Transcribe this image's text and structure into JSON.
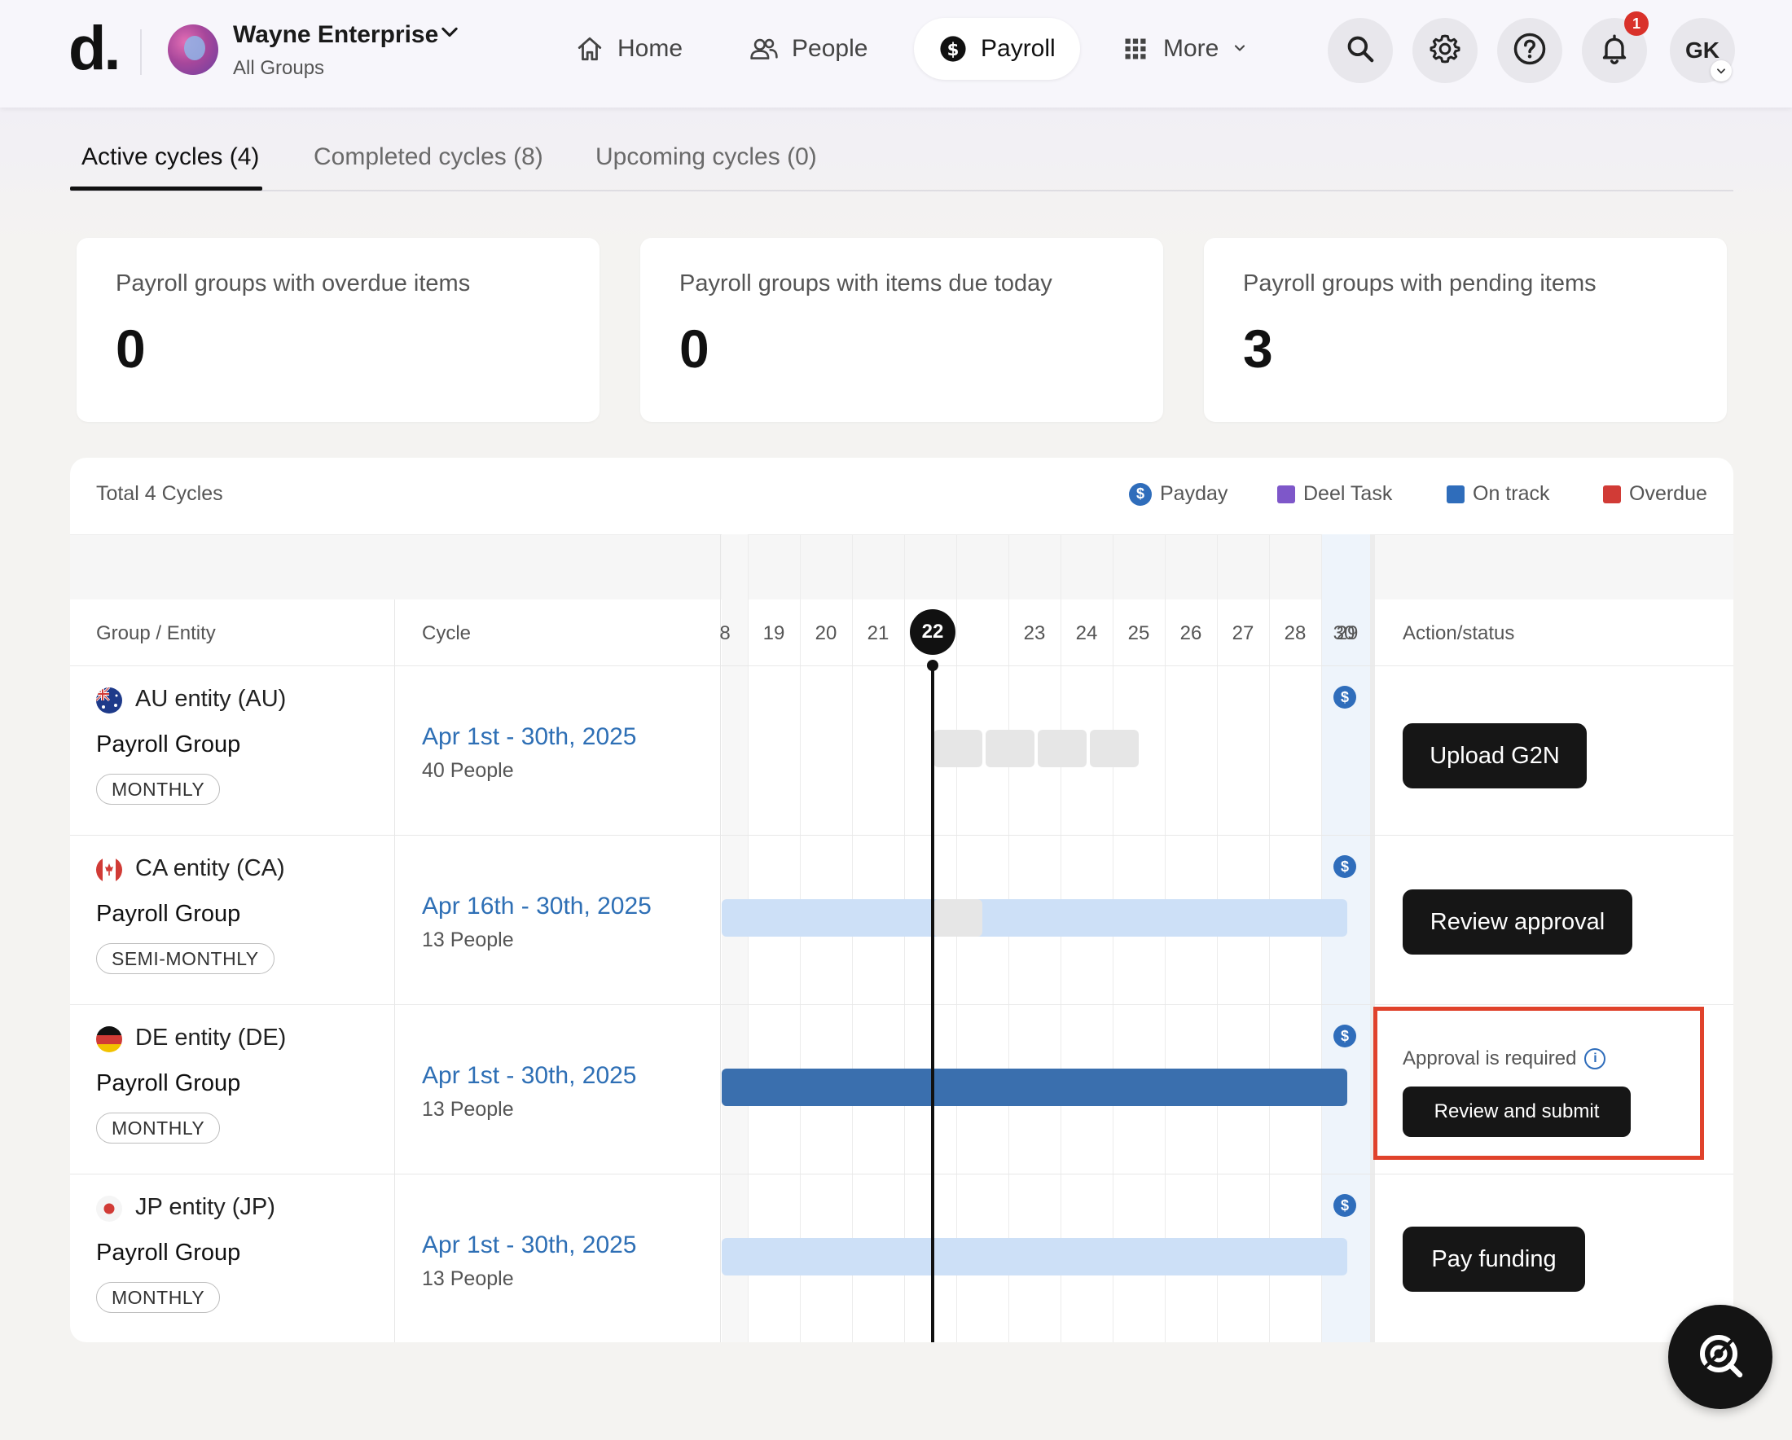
{
  "header": {
    "logo": "d.",
    "org_name": "Wayne Enterprise",
    "org_sub": "All Groups",
    "nav": [
      {
        "label": "Home",
        "icon": "home-icon"
      },
      {
        "label": "People",
        "icon": "people-icon"
      },
      {
        "label": "Payroll",
        "icon": "dollar-icon",
        "active": true
      },
      {
        "label": "More",
        "icon": "grid-icon"
      }
    ],
    "notification_count": "1",
    "user_initials": "GK"
  },
  "tabs": [
    {
      "label": "Active cycles (4)",
      "active": true
    },
    {
      "label": "Completed cycles (8)"
    },
    {
      "label": "Upcoming cycles (0)"
    }
  ],
  "stats": [
    {
      "label": "Payroll groups with overdue items",
      "value": "0"
    },
    {
      "label": "Payroll groups with items due today",
      "value": "0"
    },
    {
      "label": "Payroll groups with pending items",
      "value": "3"
    }
  ],
  "table": {
    "total": "Total 4 Cycles",
    "legend": [
      {
        "label": "Payday",
        "color": "#2f6dbb",
        "icon": "dollar-icon"
      },
      {
        "label": "Deel Task",
        "color": "#7e57c9"
      },
      {
        "label": "On track",
        "color": "#2f6dbb"
      },
      {
        "label": "Overdue",
        "color": "#d13b36"
      }
    ],
    "columns": {
      "group": "Group / Entity",
      "cycle": "Cycle",
      "action": "Action/status"
    },
    "days": [
      "8",
      "19",
      "20",
      "21",
      "22",
      "23",
      "24",
      "25",
      "26",
      "27",
      "28",
      "29",
      "30"
    ],
    "today": "22",
    "rows": [
      {
        "entity": "AU entity (AU)",
        "group": "Payroll Group",
        "frequency": "MONTHLY",
        "cycle": "Apr 1st - 30th, 2025",
        "people": "40 People",
        "action": "Upload G2N"
      },
      {
        "entity": "CA entity (CA)",
        "group": "Payroll Group",
        "frequency": "SEMI-MONTHLY",
        "cycle": "Apr 16th - 30th, 2025",
        "people": "13 People",
        "action": "Review approval"
      },
      {
        "entity": "DE entity (DE)",
        "group": "Payroll Group",
        "frequency": "MONTHLY",
        "cycle": "Apr 1st - 30th, 2025",
        "people": "13 People",
        "status_text": "Approval is required",
        "action": "Review and submit"
      },
      {
        "entity": "JP entity (JP)",
        "group": "Payroll Group",
        "frequency": "MONTHLY",
        "cycle": "Apr 1st - 30th, 2025",
        "people": "13 People",
        "action": "Pay funding"
      }
    ]
  }
}
